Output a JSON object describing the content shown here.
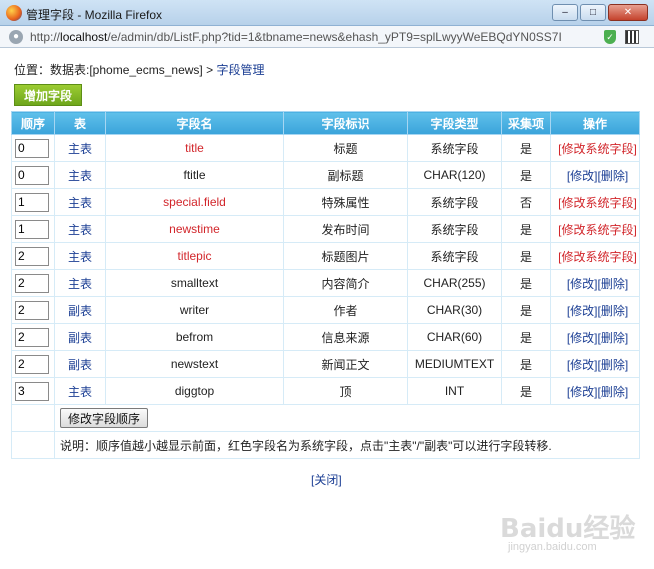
{
  "window": {
    "title": "管理字段 - Mozilla Firefox",
    "url_prefix": "http://",
    "url_host": "localhost",
    "url_rest": "/e/admin/db/ListF.php?tid=1&tbname=news&ehash_yPT9=splLwyyWeEBQdYN0SS7I"
  },
  "location": {
    "label": "位置：",
    "db_label": "数据表:[phome_ecms_news]",
    "sep": " > ",
    "current": "字段管理"
  },
  "add_button": "增加字段",
  "headers": [
    "顺序",
    "表",
    "字段名",
    "字段标识",
    "字段类型",
    "采集项",
    "操作"
  ],
  "rows": [
    {
      "order": "0",
      "table": "主表",
      "field": "title",
      "label": "标题",
      "type": "系统字段",
      "collect": "是",
      "ops": [
        "[修改系统字段]"
      ],
      "system": true
    },
    {
      "order": "0",
      "table": "主表",
      "field": "ftitle",
      "label": "副标题",
      "type": "CHAR(120)",
      "collect": "是",
      "ops": [
        "[修改]",
        "[删除]"
      ],
      "system": false
    },
    {
      "order": "1",
      "table": "主表",
      "field": "special.field",
      "label": "特殊属性",
      "type": "系统字段",
      "collect": "否",
      "ops": [
        "[修改系统字段]"
      ],
      "system": true
    },
    {
      "order": "1",
      "table": "主表",
      "field": "newstime",
      "label": "发布时间",
      "type": "系统字段",
      "collect": "是",
      "ops": [
        "[修改系统字段]"
      ],
      "system": true
    },
    {
      "order": "2",
      "table": "主表",
      "field": "titlepic",
      "label": "标题图片",
      "type": "系统字段",
      "collect": "是",
      "ops": [
        "[修改系统字段]"
      ],
      "system": true
    },
    {
      "order": "2",
      "table": "主表",
      "field": "smalltext",
      "label": "内容简介",
      "type": "CHAR(255)",
      "collect": "是",
      "ops": [
        "[修改]",
        "[删除]"
      ],
      "system": false
    },
    {
      "order": "2",
      "table": "副表",
      "field": "writer",
      "label": "作者",
      "type": "CHAR(30)",
      "collect": "是",
      "ops": [
        "[修改]",
        "[删除]"
      ],
      "system": false
    },
    {
      "order": "2",
      "table": "副表",
      "field": "befrom",
      "label": "信息来源",
      "type": "CHAR(60)",
      "collect": "是",
      "ops": [
        "[修改]",
        "[删除]"
      ],
      "system": false
    },
    {
      "order": "2",
      "table": "副表",
      "field": "newstext",
      "label": "新闻正文",
      "type": "MEDIUMTEXT",
      "collect": "是",
      "ops": [
        "[修改]",
        "[删除]"
      ],
      "system": false
    },
    {
      "order": "3",
      "table": "主表",
      "field": "diggtop",
      "label": "顶",
      "type": "INT",
      "collect": "是",
      "ops": [
        "[修改]",
        "[删除]"
      ],
      "system": false
    }
  ],
  "modify_order_button": "修改字段顺序",
  "note": "说明：顺序值越小越显示前面，红色字段名为系统字段，点击\"主表\"/\"副表\"可以进行字段转移.",
  "close_link": "[关闭]",
  "watermark": "Baidu经验",
  "watermark_sub": "jingyan.baidu.com",
  "colors": {
    "system_field": "#d2262b",
    "link": "#1c3f94",
    "header": "#3aa3da",
    "add_button": "#7cb524"
  }
}
